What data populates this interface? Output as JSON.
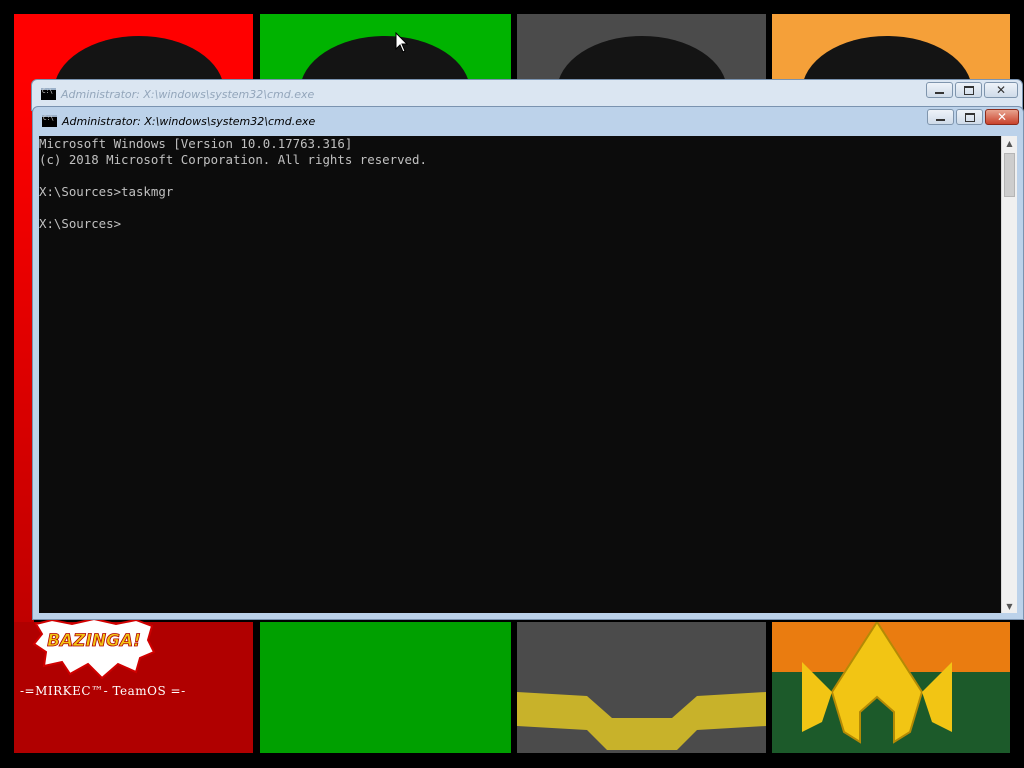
{
  "desktop": {
    "colors": {
      "red": "#ff0000",
      "green": "#00b300",
      "gray": "#4b4b4b",
      "orange": "#f5a039",
      "aqua_green": "#1c5a2a",
      "aqua_gold": "#f2c514"
    },
    "bazinga_text": "BAZINGA!",
    "signature": "-=MIRKEC™- TeamOS =-"
  },
  "background_window": {
    "title": "Administrator: X:\\windows\\system32\\cmd.exe",
    "icon": "cmd-icon"
  },
  "active_window": {
    "title": "Administrator: X:\\windows\\system32\\cmd.exe",
    "icon": "cmd-icon",
    "console_lines": [
      "Microsoft Windows [Version 10.0.17763.316]",
      "(c) 2018 Microsoft Corporation. All rights reserved.",
      "",
      "X:\\Sources>taskmgr",
      "",
      "X:\\Sources>"
    ],
    "console_colors": {
      "background": "#0c0c0c",
      "text": "#c0c0c0"
    }
  },
  "icons": {
    "minimize": "minimize-icon",
    "maximize": "maximize-icon",
    "close": "close-icon",
    "scroll_up": "chevron-up-icon",
    "scroll_down": "chevron-down-icon"
  }
}
